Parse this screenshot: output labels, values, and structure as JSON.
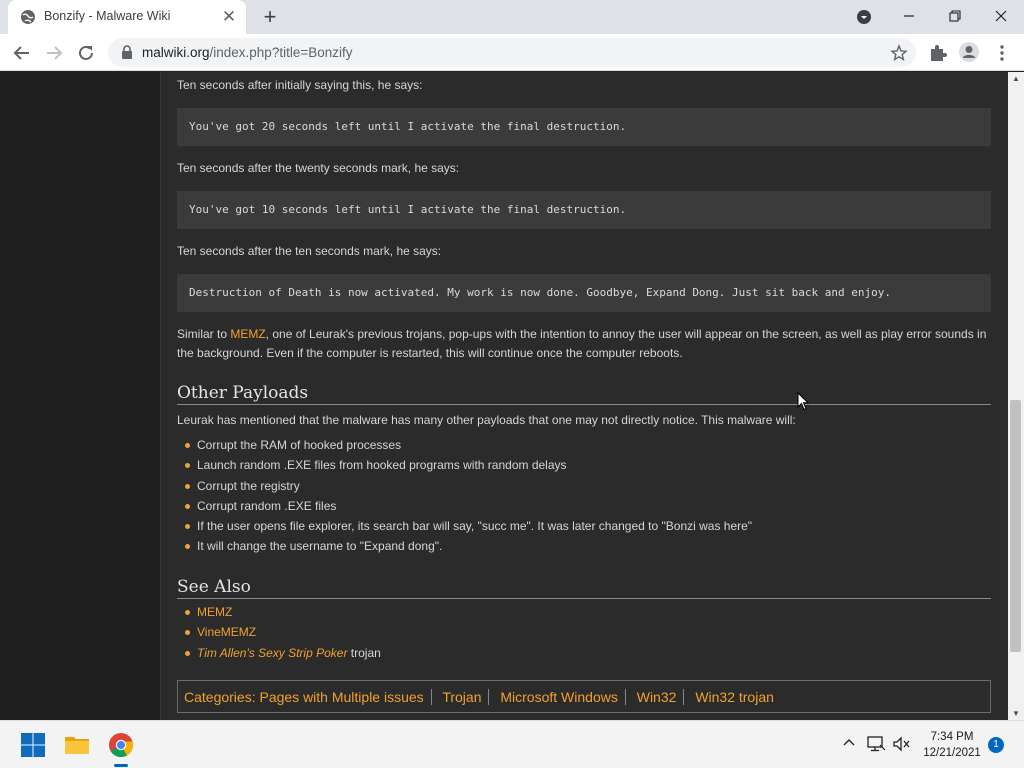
{
  "browser": {
    "tab_title": "Bonzify - Malware Wiki",
    "url_host": "malwiki.org",
    "url_path": "/index.php?title=Bonzify"
  },
  "article": {
    "p1": "Ten seconds after initially saying this, he says:",
    "code1": "You've got 20 seconds left until I activate the final destruction.",
    "p2": "Ten seconds after the twenty seconds mark, he says:",
    "code2": "You've got 10 seconds left until I activate the final destruction.",
    "p3": "Ten seconds after the ten seconds mark, he says:",
    "code3": "Destruction of Death is now activated. My work is now done. Goodbye, Expand Dong. Just sit back and enjoy.",
    "p4_before": "Similar to ",
    "p4_link": "MEMZ",
    "p4_after": ", one of Leurak's previous trojans, pop-ups with the intention to annoy the user will appear on the screen, as well as play error sounds in the background. Even if the computer is restarted, this will continue once the computer reboots.",
    "h_other": "Other Payloads",
    "p5": "Leurak has mentioned that the malware has many other payloads that one may not directly notice. This malware will:",
    "payloads": [
      "Corrupt the RAM of hooked processes",
      "Launch random .EXE files from hooked programs with random delays",
      "Corrupt the registry",
      "Corrupt random .EXE files",
      "If the user opens file explorer, its search bar will say, \"succ me\". It was later changed to \"Bonzi was here\"",
      "It will change the username to \"Expand dong\"."
    ],
    "h_see_also": "See Also",
    "see_also": {
      "link1": "MEMZ",
      "link2": "VineMEMZ",
      "link3": "Tim Allen's Sexy Strip Poker",
      "link3_suffix": " trojan"
    },
    "categories_label": "Categories",
    "categories": [
      "Pages with Multiple issues",
      "Trojan",
      "Microsoft Windows",
      "Win32",
      "Win32 trojan"
    ]
  },
  "taskbar": {
    "time": "7:34 PM",
    "date": "12/21/2021",
    "notification_count": "1"
  },
  "colors": {
    "link": "#f0a12e",
    "article_bg": "#2b2b2b",
    "code_bg": "#3b3b3b"
  }
}
